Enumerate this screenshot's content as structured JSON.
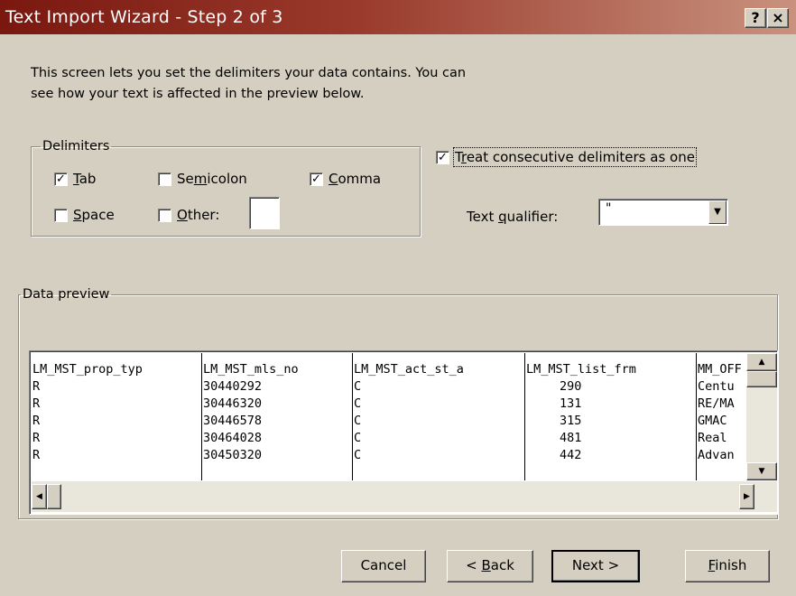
{
  "window": {
    "title": "Text Import Wizard - Step 2 of 3",
    "help_label": "?",
    "close_label": "×"
  },
  "intro": {
    "line1": "This screen lets you set the delimiters your data contains.  You can",
    "line2": "see how your text is affected in the preview below."
  },
  "delimiters": {
    "legend": "Delimiters",
    "tab": {
      "pre": "",
      "key": "T",
      "post": "ab",
      "checked": true
    },
    "semicolon": {
      "pre": "Se",
      "key": "m",
      "post": "icolon",
      "checked": false
    },
    "comma": {
      "pre": "",
      "key": "C",
      "post": "omma",
      "checked": true
    },
    "space": {
      "pre": "",
      "key": "S",
      "post": "pace",
      "checked": false
    },
    "other": {
      "pre": "",
      "key": "O",
      "post": "ther:",
      "checked": false,
      "value": ""
    }
  },
  "consecutive": {
    "pre": "T",
    "key": "r",
    "post": "eat consecutive delimiters as one",
    "checked": true
  },
  "qualifier": {
    "pre": "Text ",
    "key": "q",
    "post": "ualifier:",
    "value": "\""
  },
  "preview": {
    "legend": "Data preview",
    "columns": [
      {
        "header": "LM_MST_prop_typ",
        "cells": [
          "R",
          "R",
          "R",
          "R",
          "R"
        ]
      },
      {
        "header": "LM_MST_mls_no",
        "cells": [
          "30440292",
          "30446320",
          "30446578",
          "30464028",
          "30450320"
        ]
      },
      {
        "header": "LM_MST_act_st_a",
        "cells": [
          "C",
          "C",
          "C",
          "C",
          "C"
        ]
      },
      {
        "header": "LM_MST_list_frm",
        "cells": [
          "290",
          "131",
          "315",
          "481",
          "442"
        ]
      },
      {
        "header": "MM_OFF",
        "cells": [
          "Centu",
          "RE/MA",
          "GMAC",
          "Real",
          "Advan"
        ]
      }
    ]
  },
  "buttons": {
    "cancel": "Cancel",
    "back": {
      "pre": "< ",
      "key": "B",
      "post": "ack"
    },
    "next": "Next >",
    "finish": {
      "pre": "",
      "key": "F",
      "post": "inish"
    }
  },
  "icons": {
    "checkmark": "✓",
    "arrow_up": "▲",
    "arrow_down": "▼",
    "arrow_left": "◀",
    "arrow_right": "▶"
  }
}
